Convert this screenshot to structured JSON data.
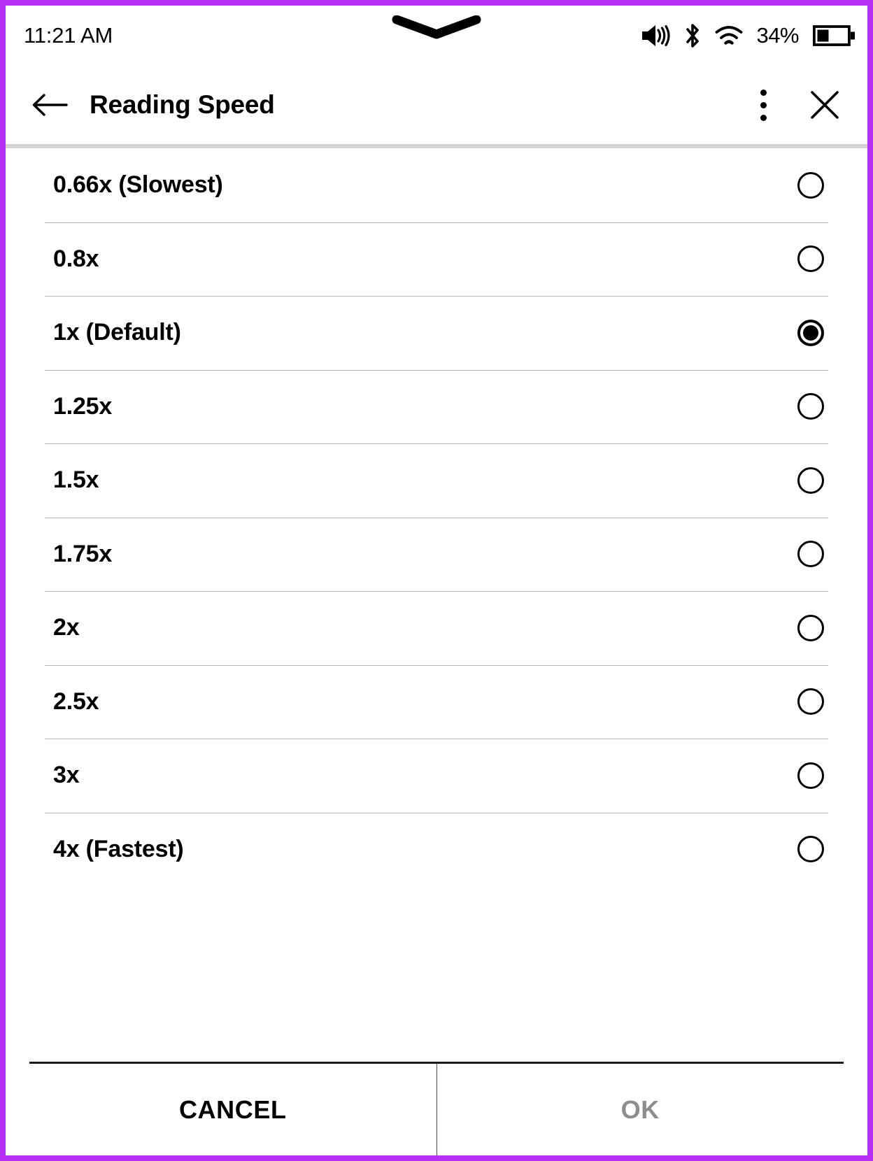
{
  "status_bar": {
    "time": "11:21 AM",
    "battery_percent": "34%",
    "icons": [
      "volume-icon",
      "bluetooth-icon",
      "wifi-icon",
      "battery-icon"
    ],
    "notch_icon": "chevron-down-handle-icon",
    "battery_level": 34
  },
  "header": {
    "back_icon": "back-arrow-icon",
    "title": "Reading Speed",
    "menu_icon": "kebab-menu-icon",
    "close_icon": "close-icon"
  },
  "list": {
    "selected_index": 2,
    "items": [
      {
        "label": "0.66x (Slowest)",
        "selected": false
      },
      {
        "label": "0.8x",
        "selected": false
      },
      {
        "label": "1x (Default)",
        "selected": true
      },
      {
        "label": "1.25x",
        "selected": false
      },
      {
        "label": "1.5x",
        "selected": false
      },
      {
        "label": "1.75x",
        "selected": false
      },
      {
        "label": "2x",
        "selected": false
      },
      {
        "label": "2.5x",
        "selected": false
      },
      {
        "label": "3x",
        "selected": false
      },
      {
        "label": "4x (Fastest)",
        "selected": false
      }
    ]
  },
  "footer": {
    "cancel_label": "CANCEL",
    "ok_label": "OK",
    "ok_enabled": false
  },
  "colors": {
    "accent_border": "#b52ff5",
    "text": "#000000",
    "disabled_text": "#8d8d8d",
    "divider": "#b4b4b4",
    "header_rule": "#d4d4d4"
  }
}
